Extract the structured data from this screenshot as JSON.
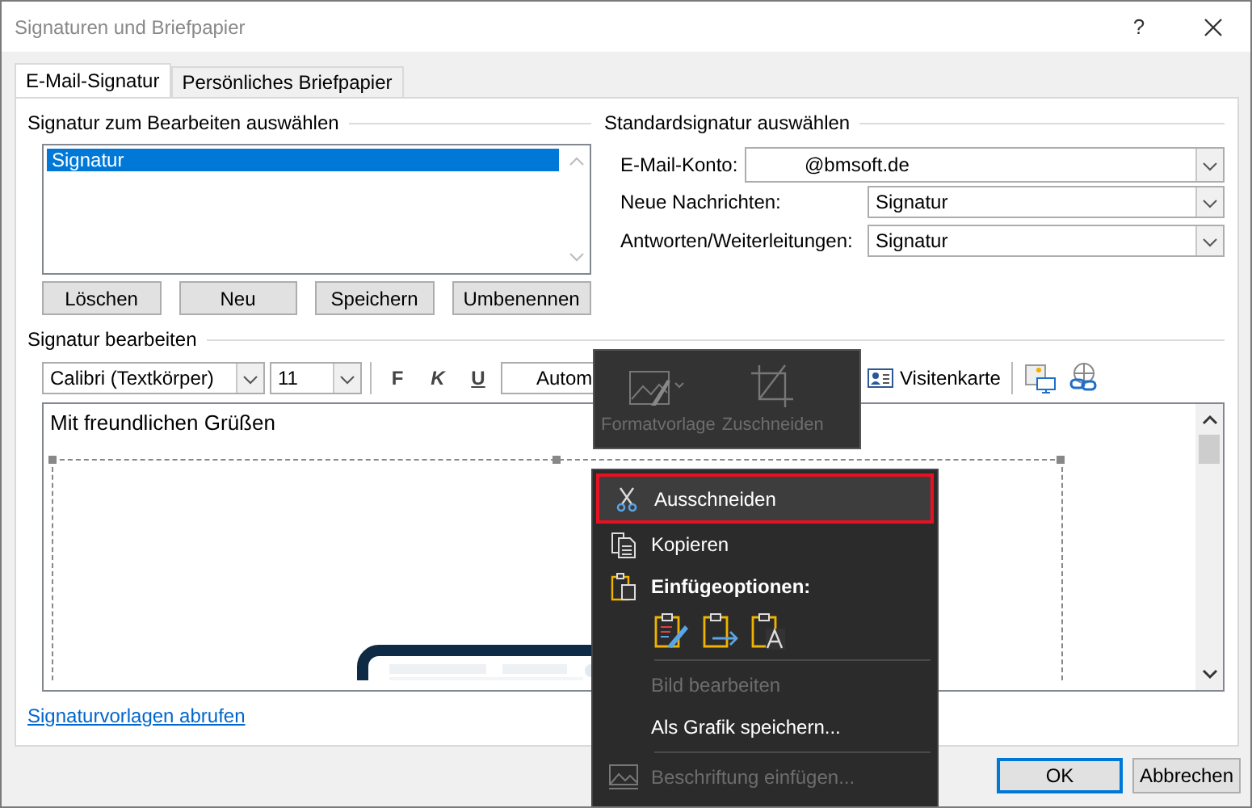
{
  "window": {
    "title": "Signaturen und Briefpapier",
    "help": "?"
  },
  "tabs": [
    {
      "label": "E-Mail-Signatur",
      "selected": true
    },
    {
      "label": "Persönliches Briefpapier",
      "selected": false
    }
  ],
  "select_signature": {
    "label": "Signatur zum Bearbeiten auswählen",
    "items": [
      {
        "label": "Signatur",
        "selected": true
      }
    ],
    "buttons": [
      "Löschen",
      "Neu",
      "Speichern",
      "Umbenennen"
    ]
  },
  "default_signature": {
    "label": "Standardsignatur auswählen",
    "fields": [
      {
        "label": "E-Mail-Konto:",
        "value": "@bmsoft.de",
        "kind": "account"
      },
      {
        "label": "Neue Nachrichten:",
        "value": "Signatur",
        "kind": "signature"
      },
      {
        "label": "Antworten/Weiterleitungen:",
        "value": "Signatur",
        "kind": "signature"
      }
    ]
  },
  "edit_signature": {
    "label": "Signatur bearbeiten",
    "font": "Calibri (Textkörper)",
    "size": "11",
    "format_buttons": [
      {
        "label": "F",
        "kind": "bold"
      },
      {
        "label": "K",
        "kind": "italic"
      },
      {
        "label": "U",
        "kind": "underline"
      }
    ],
    "color_field": "Autom",
    "business_card": "Visitenkarte",
    "body_text": "Mit freundlichen Grüßen"
  },
  "link": "Signaturvorlagen abrufen",
  "mini_toolbar": [
    {
      "label": "Formatvorlage",
      "kind": "style",
      "disabled": true
    },
    {
      "label": "Zuschneiden",
      "kind": "crop",
      "disabled": true
    }
  ],
  "context_menu": [
    {
      "kind": "cut",
      "label": "Ausschneiden",
      "selected": true,
      "disabled": false
    },
    {
      "kind": "copy",
      "label": "Kopieren",
      "selected": false,
      "disabled": false
    },
    {
      "kind": "heading",
      "label": "Einfügeoptionen:"
    },
    {
      "kind": "paste_options"
    },
    {
      "kind": "separator"
    },
    {
      "kind": "edit",
      "label": "Bild bearbeiten",
      "selected": false,
      "disabled": true
    },
    {
      "kind": "save",
      "label": "Als Grafik speichern...",
      "selected": false,
      "disabled": false
    },
    {
      "kind": "separator"
    },
    {
      "kind": "caption",
      "label": "Beschriftung einfügen...",
      "selected": false,
      "disabled": true
    }
  ],
  "buttons": [
    {
      "label": "OK",
      "default": true
    },
    {
      "label": "Abbrechen",
      "default": false
    }
  ]
}
